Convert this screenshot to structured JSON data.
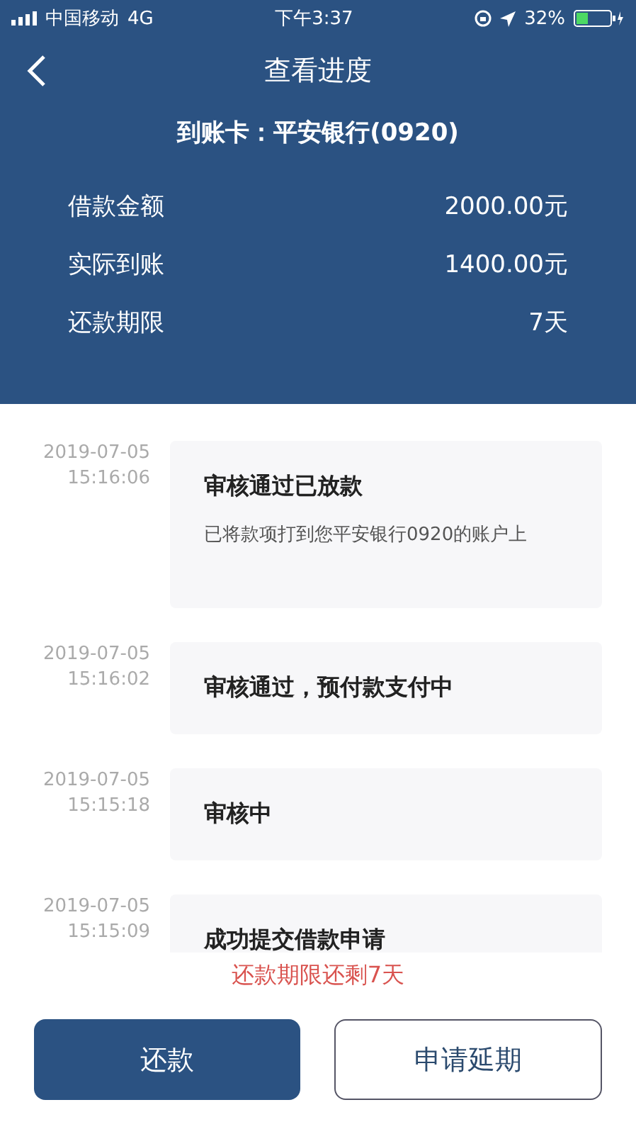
{
  "status_bar": {
    "carrier": "中国移动",
    "network": "4G",
    "time": "下午3:37",
    "battery": "32%"
  },
  "header": {
    "title": "查看进度",
    "card_label": "到账卡：",
    "card_value": "平安银行(0920)"
  },
  "summary": [
    {
      "label": "借款金额",
      "value": "2000.00元"
    },
    {
      "label": "实际到账",
      "value": "1400.00元"
    },
    {
      "label": "还款期限",
      "value": "7天"
    }
  ],
  "timeline": [
    {
      "date": "2019-07-05",
      "time": "15:16:06",
      "title": "审核通过已放款",
      "detail": "已将款项打到您平安银行0920的账户上"
    },
    {
      "date": "2019-07-05",
      "time": "15:16:02",
      "title": "审核通过，预付款支付中"
    },
    {
      "date": "2019-07-05",
      "time": "15:15:18",
      "title": "审核中"
    },
    {
      "date": "2019-07-05",
      "time": "15:15:09",
      "title": "成功提交借款申请"
    }
  ],
  "notice": "还款期限还剩7天",
  "buttons": [
    {
      "label": "还款",
      "kind": "primary"
    },
    {
      "label": "申请延期",
      "kind": "outline"
    }
  ]
}
